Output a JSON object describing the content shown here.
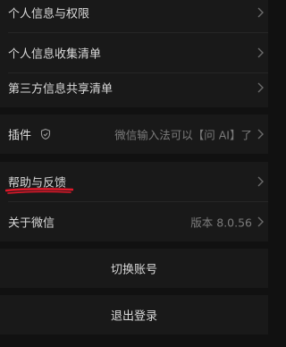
{
  "settings": {
    "privacy_items": [
      {
        "label": "个人信息与权限"
      },
      {
        "label": "个人信息收集清单"
      },
      {
        "label": "第三方信息共享清单"
      }
    ],
    "plugins": {
      "label": "插件",
      "value": "微信输入法可以【问 AI】了",
      "icon": "shield-icon"
    },
    "help": {
      "label": "帮助与反馈"
    },
    "about": {
      "label": "关于微信",
      "value": "版本 8.0.56"
    },
    "switch_account": "切换账号",
    "logout": "退出登录"
  },
  "colors": {
    "background": "#111111",
    "card": "#191919",
    "text": "#d9d9d9",
    "secondary_text": "#7b7b7b",
    "annotation_red": "#e0182a"
  }
}
